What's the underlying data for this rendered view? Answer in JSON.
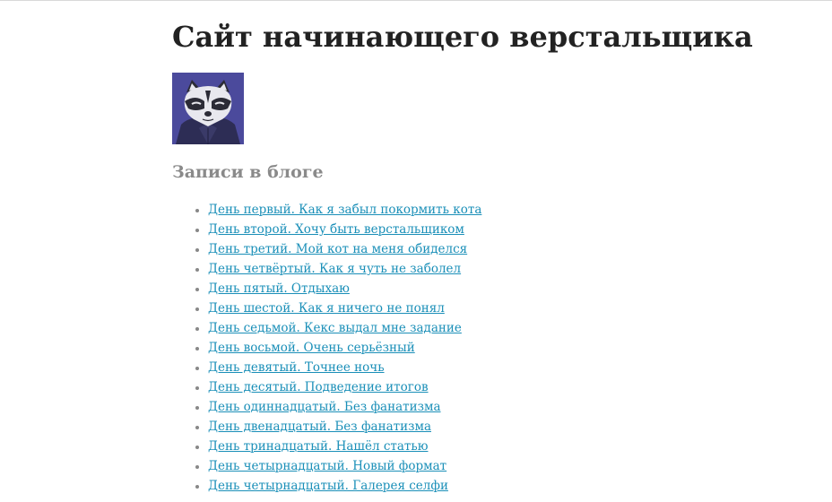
{
  "header": {
    "title": "Сайт начинающего верстальщика"
  },
  "avatar": {
    "icon": "raccoon-avatar-icon",
    "colors": {
      "background": "#4b4a9c",
      "hood": "#2d2d55",
      "fur_light": "#e8e8ee",
      "mask": "#2b2b36"
    }
  },
  "blog": {
    "heading": "Записи в блоге",
    "posts": [
      "День первый. Как я забыл покормить кота",
      "День второй. Хочу быть верстальщиком",
      "День третий. Мой кот на меня обиделся",
      "День четвёртый. Как я чуть не заболел",
      "День пятый. Отдыхаю",
      "День шестой. Как я ничего не понял",
      "День седьмой. Кекс выдал мне задание",
      "День восьмой. Очень серьёзный",
      "День девятый. Точнее ночь",
      "День десятый. Подведение итогов",
      "День одиннадцатый. Без фанатизма",
      "День двенадцатый. Без фанатизма",
      "День тринадцатый. Нашёл статью",
      "День четырнадцатый. Новый формат",
      "День четырнадцатый. Галерея селфи"
    ]
  },
  "colors": {
    "link": "#1a8fb8",
    "heading": "#222222",
    "subheading": "#8a8a8a",
    "bullet": "#888888"
  }
}
